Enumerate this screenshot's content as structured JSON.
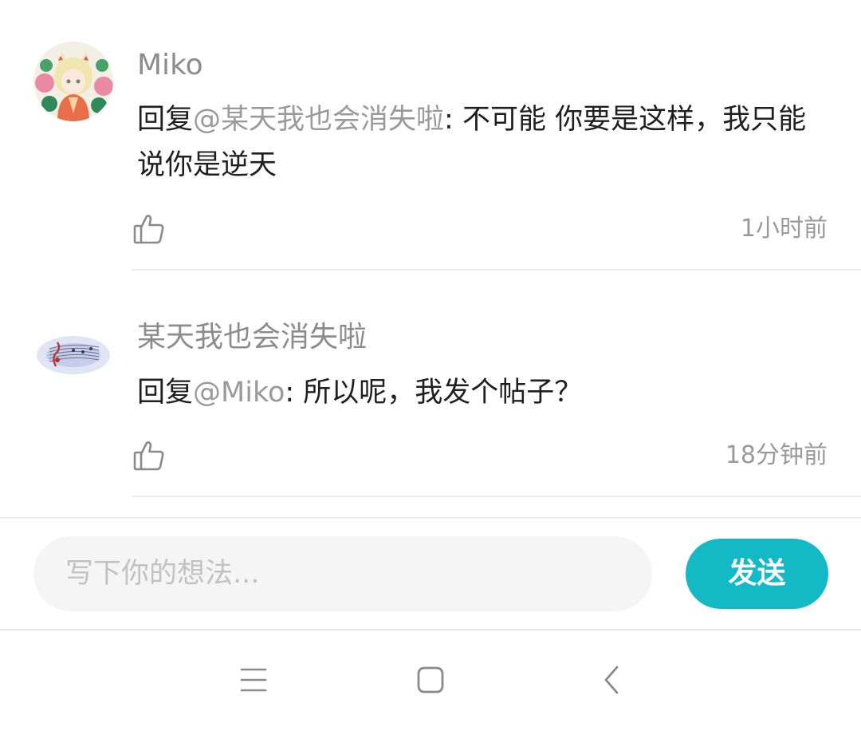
{
  "comments": [
    {
      "username": "Miko",
      "reply_prefix": "回复",
      "mention": "@某天我也会消失啦",
      "text": ": 不可能 你要是这样，我只能说你是逆天",
      "time": "1小时前",
      "avatar_icon": "anime-girl-avatar-icon"
    },
    {
      "username": "某天我也会消失啦",
      "reply_prefix": "回复",
      "mention": "@Miko",
      "text": ": 所以呢，我发个帖子？",
      "time": "18分钟前",
      "avatar_icon": "music-staff-avatar-icon"
    }
  ],
  "composer": {
    "placeholder": "写下你的想法...",
    "send_label": "发送"
  },
  "colors": {
    "accent": "#14b9c6",
    "mention": "#9a9a9a",
    "divider": "#eeeeee"
  },
  "navbar": {
    "icons": [
      "menu-icon",
      "home-icon",
      "back-icon"
    ]
  }
}
